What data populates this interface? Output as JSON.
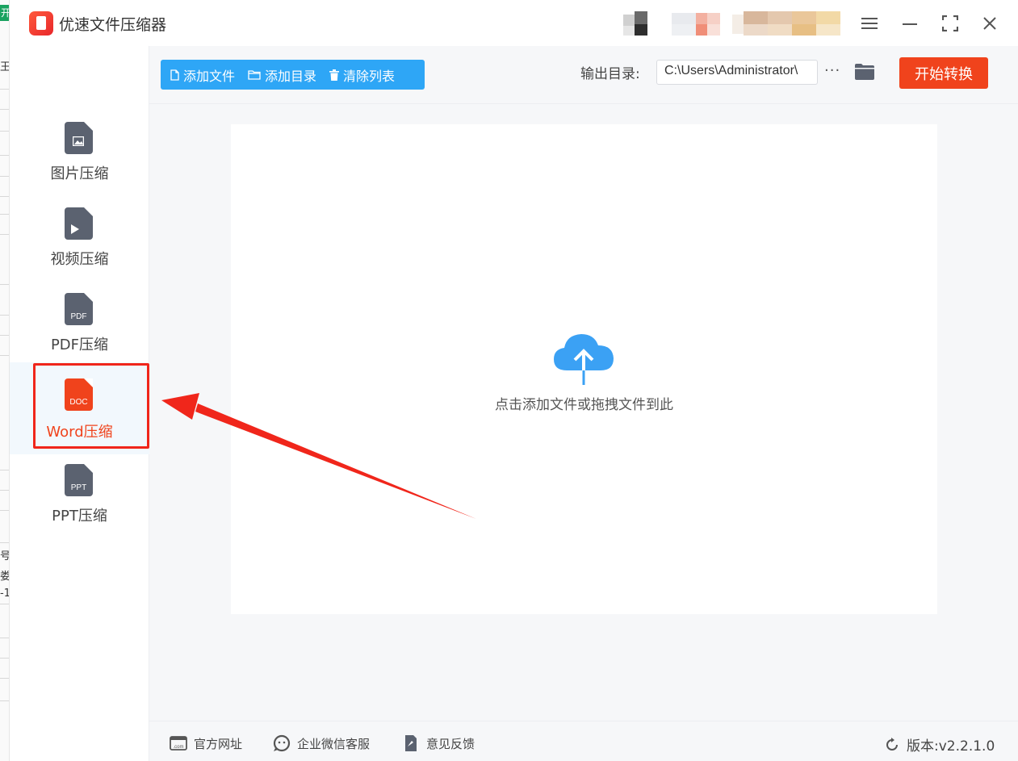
{
  "background_window": {
    "top_cell": "开",
    "cells": [
      "王",
      "号",
      "娄",
      "-1"
    ]
  },
  "app": {
    "title": "优速文件压缩器"
  },
  "window_controls": {
    "menu_icon": "menu-icon",
    "minimize_icon": "minimize-icon",
    "maximize_icon": "maximize-icon",
    "close_icon": "close-icon"
  },
  "sidebar": {
    "items": [
      {
        "label": "图片压缩",
        "icon": "image-file-icon",
        "badge": "",
        "active": false
      },
      {
        "label": "视频压缩",
        "icon": "video-file-icon",
        "badge": "",
        "active": false
      },
      {
        "label": "PDF压缩",
        "icon": "pdf-file-icon",
        "badge": "PDF",
        "active": false
      },
      {
        "label": "Word压缩",
        "icon": "doc-file-icon",
        "badge": "DOC",
        "active": true
      },
      {
        "label": "PPT压缩",
        "icon": "ppt-file-icon",
        "badge": "PPT",
        "active": false
      }
    ]
  },
  "toolbar": {
    "add_file": "添加文件",
    "add_folder": "添加目录",
    "clear_list": "清除列表",
    "output_label": "输出目录:",
    "output_path": "C:\\Users\\Administrator\\",
    "more": "···",
    "start": "开始转换"
  },
  "drop_zone": {
    "hint": "点击添加文件或拖拽文件到此"
  },
  "footer": {
    "website": "官方网址",
    "wechat": "企业微信客服",
    "feedback": "意见反馈",
    "version": "版本:v2.2.1.0"
  },
  "colors": {
    "accent_blue": "#2ea6f6",
    "accent_red": "#f0431c",
    "annotation_red": "#f0261b"
  }
}
